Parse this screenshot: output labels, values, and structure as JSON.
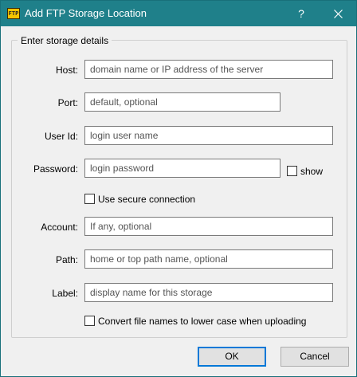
{
  "window": {
    "title": "Add FTP Storage Location",
    "app_icon_text": "FTP",
    "help_label": "?"
  },
  "group": {
    "legend": "Enter storage details"
  },
  "fields": {
    "host": {
      "label": "Host:",
      "placeholder": "domain name or IP address of the server"
    },
    "port": {
      "label": "Port:",
      "placeholder": "default, optional"
    },
    "user_id": {
      "label": "User Id:",
      "placeholder": "login user name"
    },
    "password": {
      "label": "Password:",
      "placeholder": "login password"
    },
    "account": {
      "label": "Account:",
      "placeholder": "If any, optional"
    },
    "path": {
      "label": "Path:",
      "placeholder": "home or top path name, optional"
    },
    "label": {
      "label": "Label:",
      "placeholder": "display name for this storage"
    }
  },
  "checkboxes": {
    "show": {
      "label": "show",
      "checked": false
    },
    "secure": {
      "label": "Use secure connection",
      "checked": false
    },
    "lowercase": {
      "label": "Convert file names to lower case when uploading",
      "checked": false
    }
  },
  "buttons": {
    "ok": "OK",
    "cancel": "Cancel"
  },
  "colors": {
    "titlebar": "#1f808a",
    "window_bg": "#f0f0f0",
    "default_button_border": "#0078d7"
  }
}
